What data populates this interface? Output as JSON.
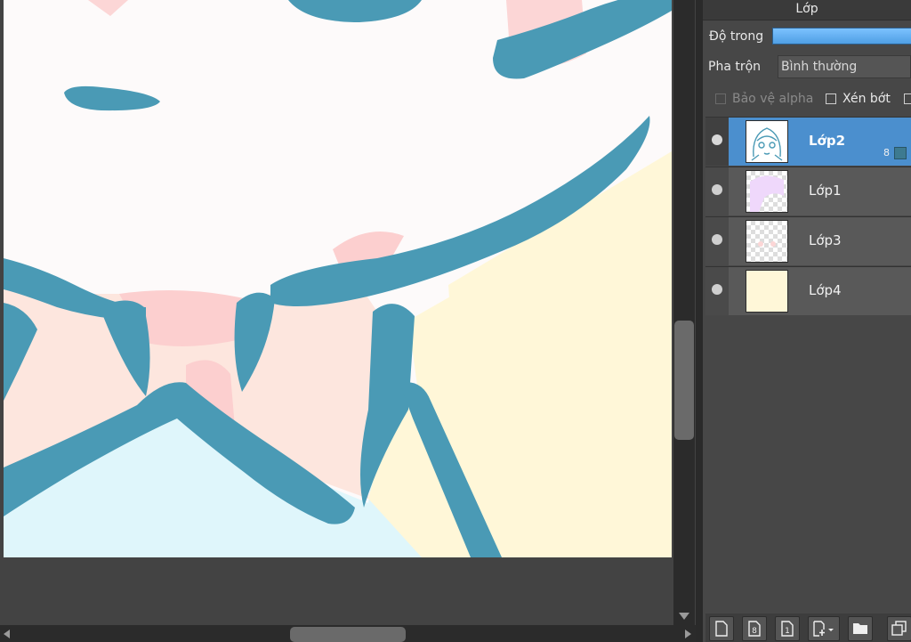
{
  "panel": {
    "title": "Lớp",
    "opacity_label": "Độ trong",
    "opacity_value": 1.0,
    "blend_label": "Pha trộn",
    "blend_value": "Bình thường",
    "protect_alpha_label": "Bảo vệ alpha",
    "clipping_label": "Xén bớt"
  },
  "layers": [
    {
      "name": "Lớp2",
      "selected": true,
      "visible": true,
      "count": "8"
    },
    {
      "name": "Lớp1",
      "selected": false,
      "visible": true
    },
    {
      "name": "Lớp3",
      "selected": false,
      "visible": true
    },
    {
      "name": "Lớp4",
      "selected": false,
      "visible": true
    }
  ],
  "toolbar": {
    "icons": [
      "new-layer-icon",
      "new-8bit-layer-icon",
      "new-1bit-layer-icon",
      "add-layer-dropdown-icon",
      "new-folder-icon",
      "duplicate-layer-icon"
    ]
  },
  "colors": {
    "selection": "#4b8fce",
    "line_art": "#4a9ab5",
    "skin": "#fde6de",
    "blush": "#fccfcf",
    "background": "#fff7d8",
    "cloth": "#dff6fb"
  }
}
